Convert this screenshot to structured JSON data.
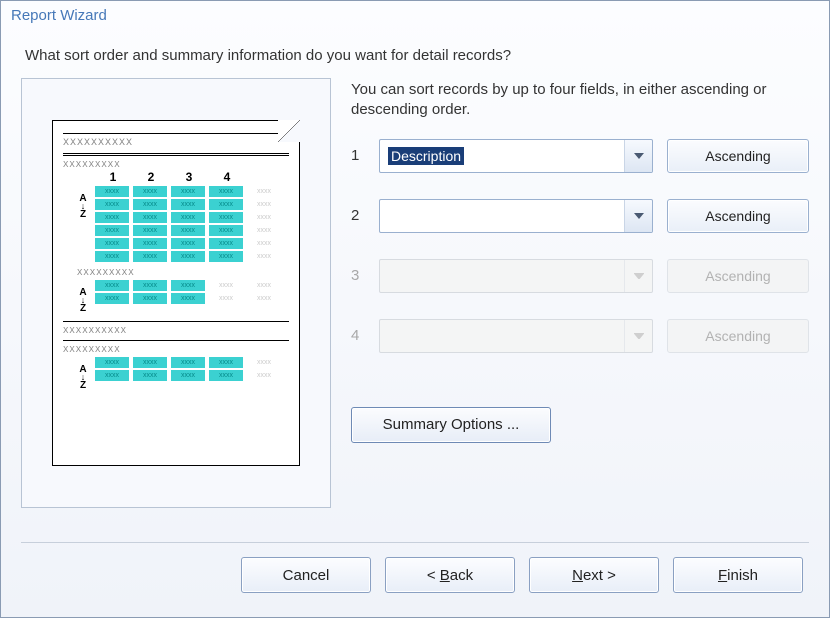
{
  "window": {
    "title": "Report Wizard"
  },
  "question": "What sort order and summary information do you want for detail records?",
  "instruction": "You can sort records by up to four fields, in either ascending or descending order.",
  "sort_rows": [
    {
      "index": "1",
      "value": "Description",
      "order": "Ascending",
      "enabled": true,
      "selected": true
    },
    {
      "index": "2",
      "value": "",
      "order": "Ascending",
      "enabled": true,
      "selected": false
    },
    {
      "index": "3",
      "value": "",
      "order": "Ascending",
      "enabled": false,
      "selected": false
    },
    {
      "index": "4",
      "value": "",
      "order": "Ascending",
      "enabled": false,
      "selected": false
    }
  ],
  "summary_button": "Summary Options ...",
  "footer": {
    "cancel": "Cancel",
    "back_prefix": "< ",
    "back_u": "B",
    "back_rest": "ack",
    "next_u": "N",
    "next_rest": "ext >",
    "finish_u": "F",
    "finish_rest": "inish"
  },
  "preview": {
    "headers": [
      "1",
      "2",
      "3",
      "4"
    ]
  }
}
